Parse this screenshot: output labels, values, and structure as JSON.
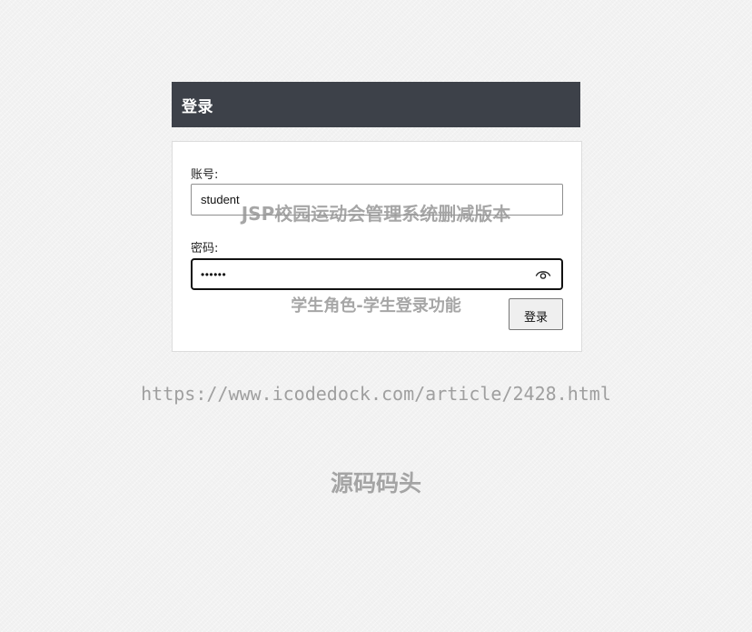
{
  "login_panel": {
    "title": "登录",
    "account_label": "账号:",
    "account_value": "student",
    "password_label": "密码:",
    "password_value": "••••••",
    "password_toggle_icon": "eye-icon",
    "submit_label": "登录"
  },
  "watermarks": {
    "title": "JSP校园运动会管理系统删减版本",
    "subtitle": "学生角色-学生登录功能",
    "url": "https://www.icodedock.com/article/2428.html",
    "brand": "源码码头"
  },
  "colors": {
    "header_background": "#3d4149",
    "page_background": "#f2f2f2",
    "watermark_text": "#969696"
  }
}
